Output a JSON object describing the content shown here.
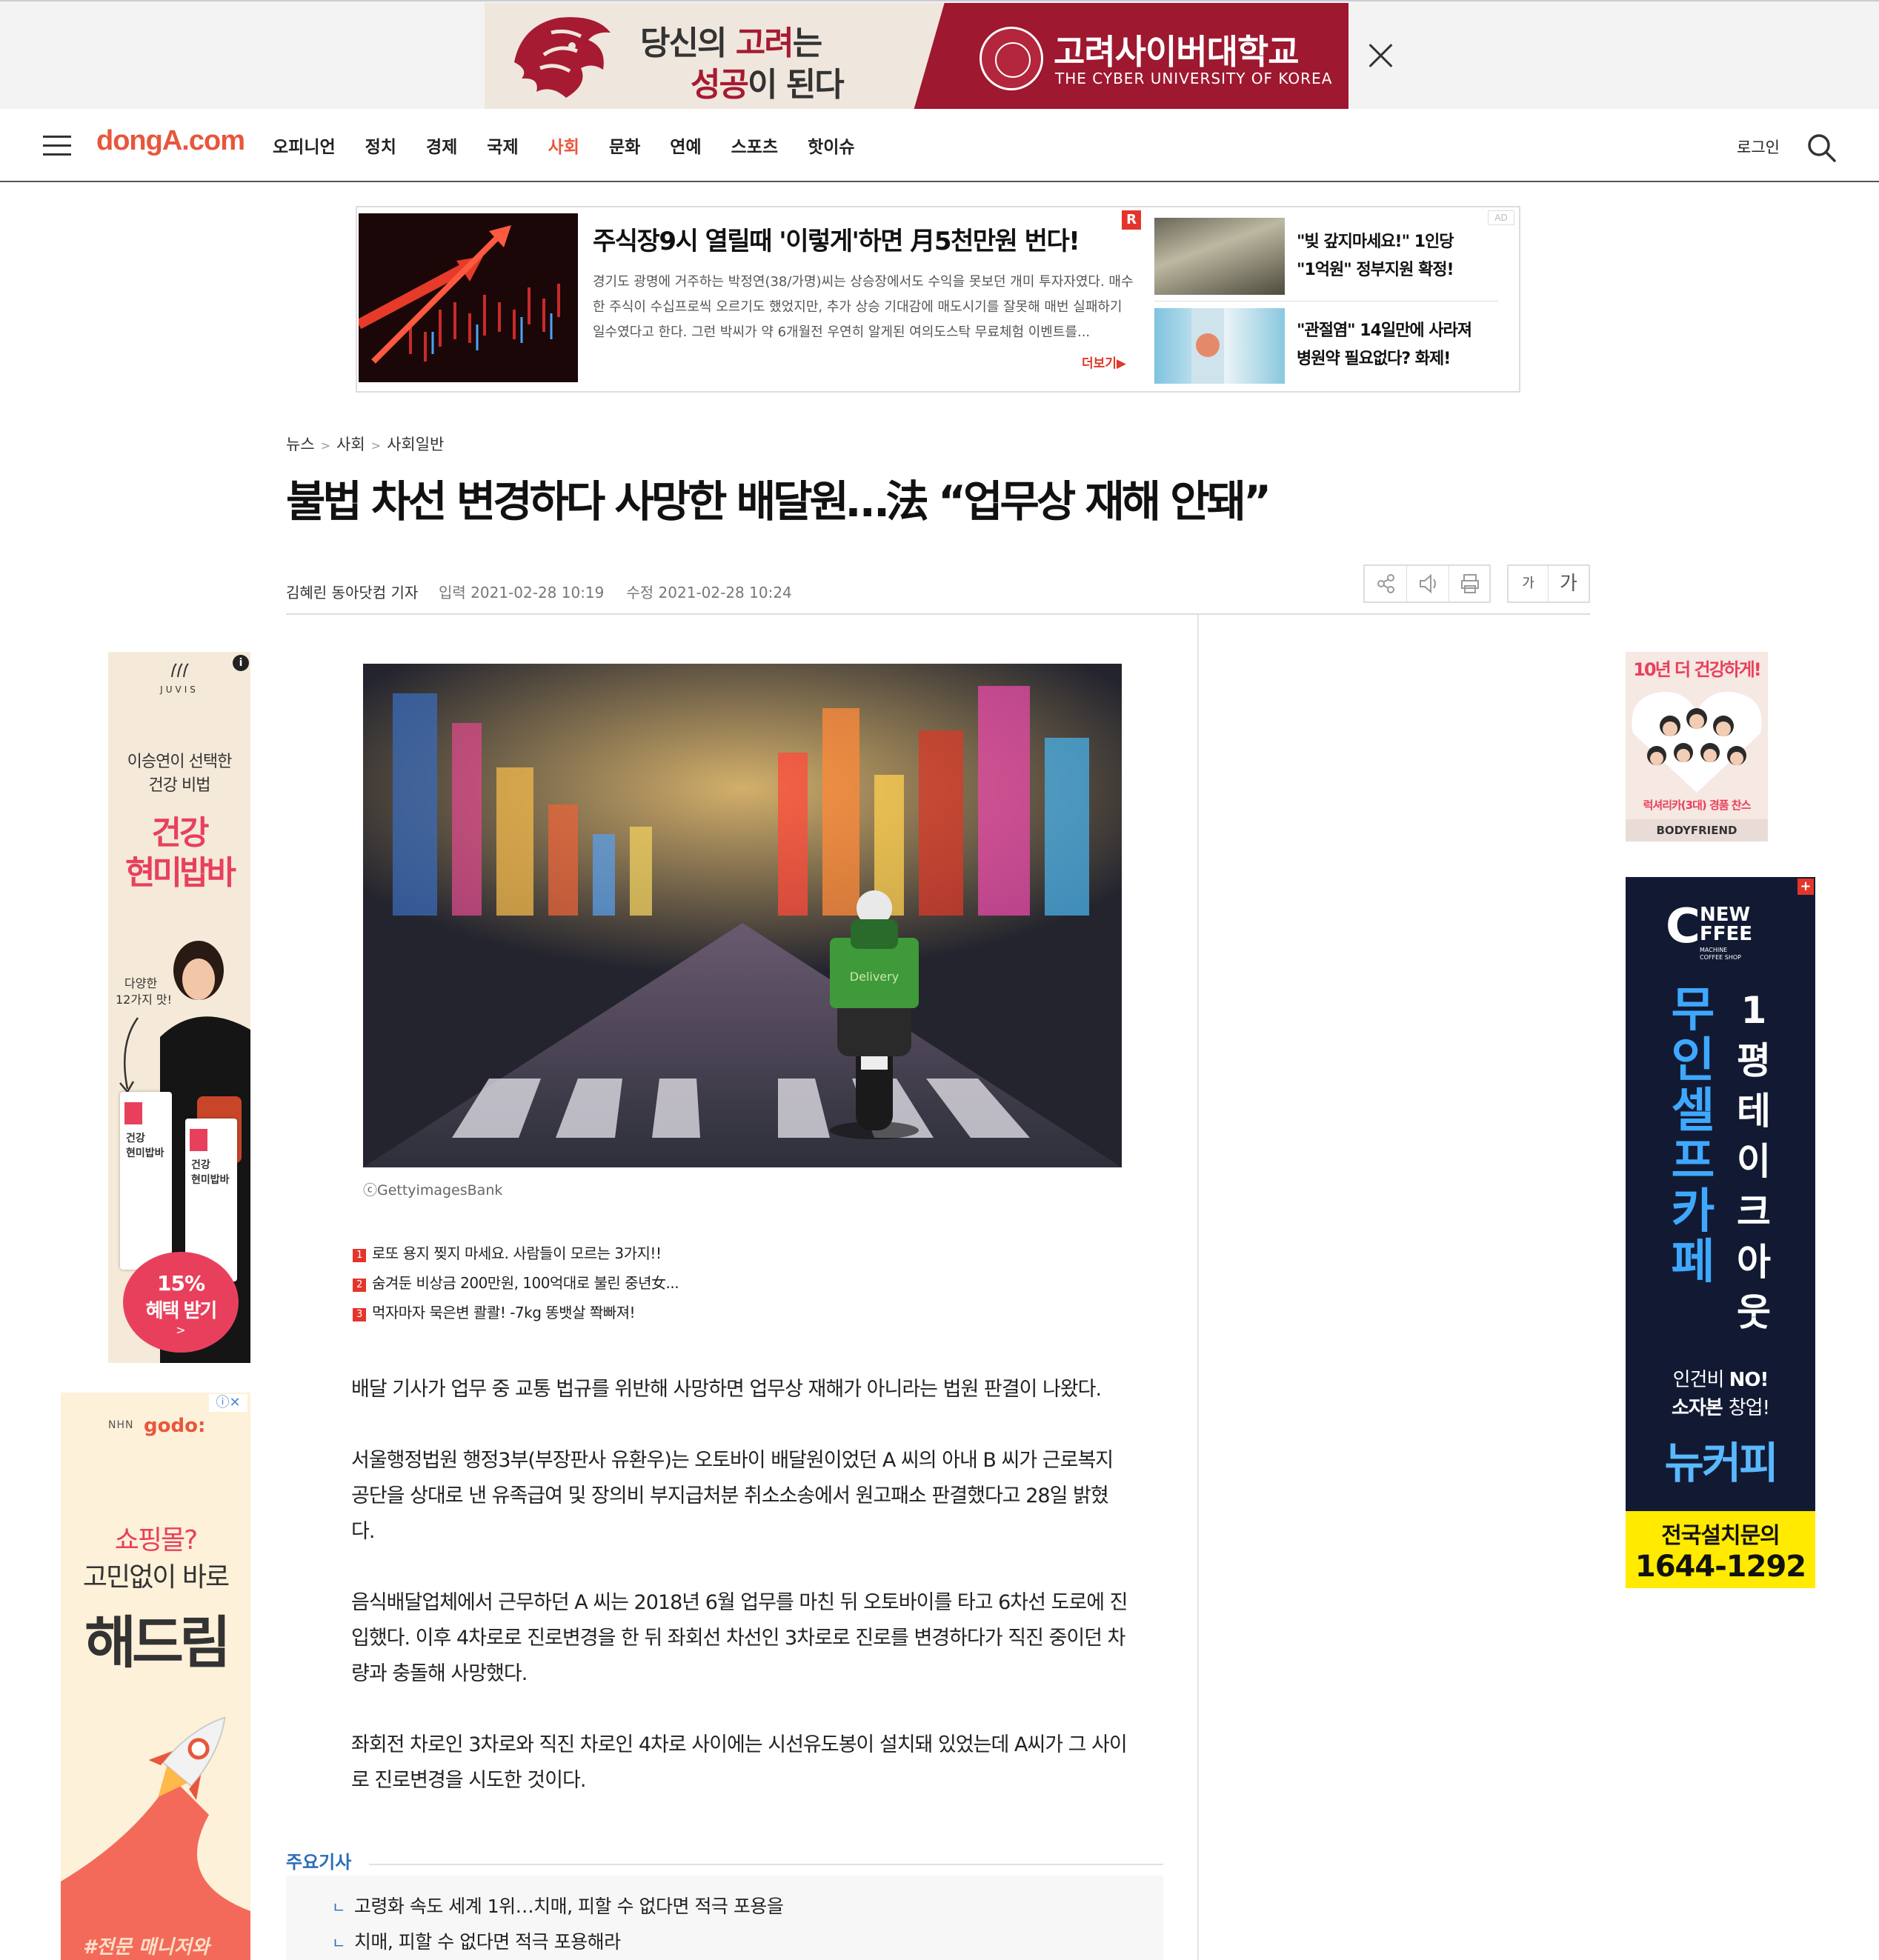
{
  "top_ad": {
    "slogan_line1_a": "당신의 ",
    "slogan_line1_b": "고려",
    "slogan_line1_c": "는",
    "slogan_line2_a": "성공",
    "slogan_line2_b": "이 된다",
    "univ_name": "고려사이버대학교",
    "univ_en": "THE CYBER UNIVERSITY OF KOREA"
  },
  "nav": {
    "logo": "dongA.com",
    "menu": [
      "오피니언",
      "정치",
      "경제",
      "국제",
      "사회",
      "문화",
      "연예",
      "스포츠",
      "핫이슈"
    ],
    "active": "사회",
    "login": "로그인"
  },
  "sponsor": {
    "title": "주식장9시 열릴때 '이렇게'하면 月5천만원 번다!",
    "body": "경기도 광명에 거주하는 박정연(38/가명)씨는 상승장에서도 수익을 못보던 개미 투자자였다. 매수한 주식이 수십프로씩 오르기도 했었지만, 추가 상승 기대감에 매도시기를 잘못해 매번 실패하기 일수였다고 한다. 그런 박씨가 약 6개월전 우연히 알게된 여의도스탁 무료체험 이벤트를...",
    "more": "더보기▶",
    "r_badge": "R",
    "ad_badge": "AD",
    "item2_line1": "\"빚 갚지마세요!\" 1인당",
    "item2_line2": "\"1억원\" 정부지원 확정!",
    "item3_line1": "\"관절염\" 14일만에 사라져",
    "item3_line2": "병원약 필요없다? 화제!"
  },
  "article": {
    "breadcrumb": [
      "뉴스",
      "사회",
      "사회일반"
    ],
    "headline": "불법 차선 변경하다 사망한 배달원…法 “업무상 재해 안돼”",
    "byline": "김혜린 동아닷컴 기자",
    "published": "입력 2021-02-28 10:19",
    "modified": "수정 2021-02-28 10:24",
    "font_small": "가",
    "font_large": "가",
    "photo_credit": "ⓒGettyimagesBank",
    "photo_sign": "Delivery",
    "related": [
      {
        "num": "1",
        "text": "로또 용지 찢지 마세요. 사람들이 모르는 3가지!!"
      },
      {
        "num": "2",
        "text": "숨겨둔 비상금 200만원, 100억대로 불린 중년女..."
      },
      {
        "num": "3",
        "text": "먹자마자 묵은변 콸콸! -7kg 똥뱃살 쫙빠져!"
      }
    ],
    "paragraphs": [
      [
        "배달 기사가 업무 중 교통 법규를 위반해 사망하면 업무상 재해가 아니라는 법원 판결이 나왔다."
      ],
      [
        "서울행정법원 행정3부(부장판사 유환우)는 오토바이 배달원이었던 A 씨의 아내 B 씨가 근로복지",
        "공단을 상대로 낸 유족급여 및 장의비 부지급처분 취소소송에서 원고패소 판결했다고 28일 밝혔",
        "다."
      ],
      [
        "음식배달업체에서 근무하던 A 씨는 2018년 6월 업무를 마친 뒤 오토바이를 타고 6차선 도로에 진",
        "입했다. 이후 4차로로 진로변경을 한 뒤 좌회선 차선인 3차로로 진로를 변경하다가 직진 중이던 차",
        "량과 충돌해 사망했다."
      ],
      [
        "좌회전 차로인 3차로와 직진 차로인 4차로 사이에는 시선유도봉이 설치돼 있었는데 A씨가 그 사이",
        "로 진로변경을 시도한 것이다."
      ]
    ],
    "main_heading": "주요기사",
    "main_items": [
      "고령화 속도 세계 1위…치매, 피할 수 없다면 적극 포용을",
      "치매, 피할 수 없다면 적극 포용해라"
    ]
  },
  "ads": {
    "juvis": {
      "brand": "JUVIS",
      "line1": "이승연이 선택한",
      "line2": "건강 비법",
      "big1": "건강",
      "big2": "현미밥바",
      "note1": "다양한",
      "note2": "12가지 맛!",
      "pack1": "건강\n현미밥바",
      "pack2": "건강\n현미밥바",
      "badge1": "15%",
      "badge2": "혜택 받기",
      "badge3": ">",
      "info": "i"
    },
    "godo": {
      "brand": "godo:",
      "brand_prefix": "NHN",
      "line1": "쇼핑몰?",
      "line2": "고민없이 바로",
      "big": "해드림",
      "bottom": "#전문 매니저와",
      "info": "ⓘ✕"
    },
    "bodyfriend": {
      "headline": "10년 더 건강하게!",
      "promo": "럭셔리카(3대) 경품 찬스",
      "brand": "BODYFRIEND"
    },
    "coffee": {
      "logo_c": "C",
      "logo_new": "NEW",
      "logo_ffee": "FFEE",
      "logo_sub": "MACHINE COFFEE SHOP",
      "col1": [
        "무",
        "인",
        "셀",
        "프",
        "카",
        "페"
      ],
      "col2": [
        "1",
        "평",
        "테",
        "이",
        "크",
        "아",
        "웃"
      ],
      "line1_a": "인건비 ",
      "line1_b": "NO!",
      "line2_a": "소자본 ",
      "line2_b": "창업!",
      "brand": "뉴커피",
      "contact_label": "전국설치문의",
      "phone": "1644-1292",
      "plus": "+"
    }
  },
  "colors": {
    "accent": "#e8563c",
    "link_blue": "#2b6cb8",
    "ad_red": "#9e1830"
  }
}
